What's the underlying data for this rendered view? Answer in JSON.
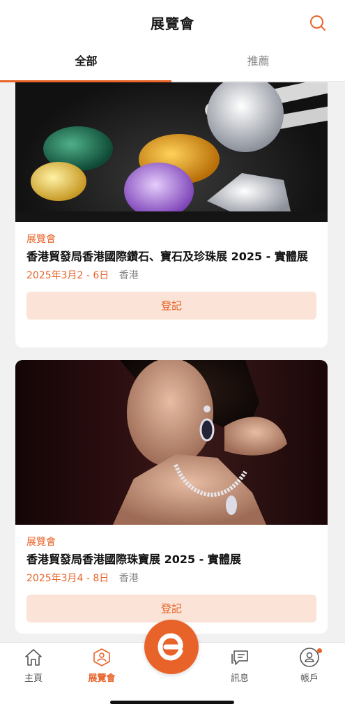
{
  "header": {
    "title": "展覽會"
  },
  "tabs": [
    {
      "label": "全部",
      "active": true
    },
    {
      "label": "推薦",
      "active": false
    }
  ],
  "cards": [
    {
      "category": "展覽會",
      "title": "香港貿發局香港國際鑽石、寶石及珍珠展 2025 - 實體展",
      "date": "2025年3月2 - 6日",
      "location": "香港",
      "button": "登記",
      "image": "gemstones-photo"
    },
    {
      "category": "展覽會",
      "title": "香港貿發局香港國際珠寶展 2025 - 實體展",
      "date": "2025年3月4 - 8日",
      "location": "香港",
      "button": "登記",
      "image": "jewelry-model-photo"
    }
  ],
  "tabbar": {
    "items": [
      {
        "label": "主頁",
        "icon": "home-icon",
        "active": false
      },
      {
        "label": "展覽會",
        "icon": "exhibition-icon",
        "active": true
      },
      {
        "label": "訊息",
        "icon": "message-icon",
        "active": false
      },
      {
        "label": "帳戶",
        "icon": "account-icon",
        "active": false
      }
    ],
    "center_icon": "logo-e-icon"
  },
  "colors": {
    "accent": "#e8632a",
    "button_bg": "#fbe4d7",
    "background": "#f1f1f1"
  }
}
